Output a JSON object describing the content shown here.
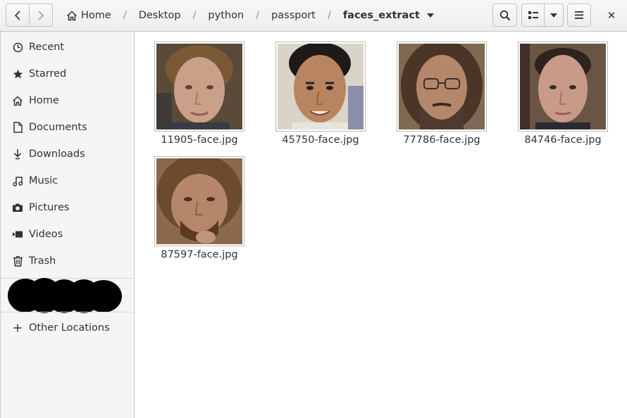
{
  "header": {
    "breadcrumbs": [
      "Home",
      "Desktop",
      "python",
      "passport",
      "faces_extract"
    ],
    "close_symbol": "✕"
  },
  "sidebar": {
    "items": [
      {
        "label": "Recent",
        "icon": "clock-icon"
      },
      {
        "label": "Starred",
        "icon": "star-icon"
      },
      {
        "label": "Home",
        "icon": "home-icon"
      },
      {
        "label": "Documents",
        "icon": "document-icon"
      },
      {
        "label": "Downloads",
        "icon": "download-icon"
      },
      {
        "label": "Music",
        "icon": "music-icon"
      },
      {
        "label": "Pictures",
        "icon": "camera-icon"
      },
      {
        "label": "Videos",
        "icon": "video-icon"
      },
      {
        "label": "Trash",
        "icon": "trash-icon"
      }
    ],
    "other_locations": "Other Locations"
  },
  "files": [
    {
      "name": "11905-face.jpg",
      "skin": "#c9a088",
      "hair": "#7a5a35",
      "bg": "#5a4a3a"
    },
    {
      "name": "45750-face.jpg",
      "skin": "#b98460",
      "hair": "#1e1a17",
      "bg": "#d9d4c8"
    },
    {
      "name": "77786-face.jpg",
      "skin": "#b4876b",
      "hair": "#4a3526",
      "bg": "#7e6a52"
    },
    {
      "name": "84746-face.jpg",
      "skin": "#c99a88",
      "hair": "#2e241f",
      "bg": "#6a5545"
    },
    {
      "name": "87597-face.jpg",
      "skin": "#b5866a",
      "hair": "#6b4a30",
      "bg": "#8a6a4a"
    }
  ],
  "colors": {
    "redaction": "#000000"
  }
}
